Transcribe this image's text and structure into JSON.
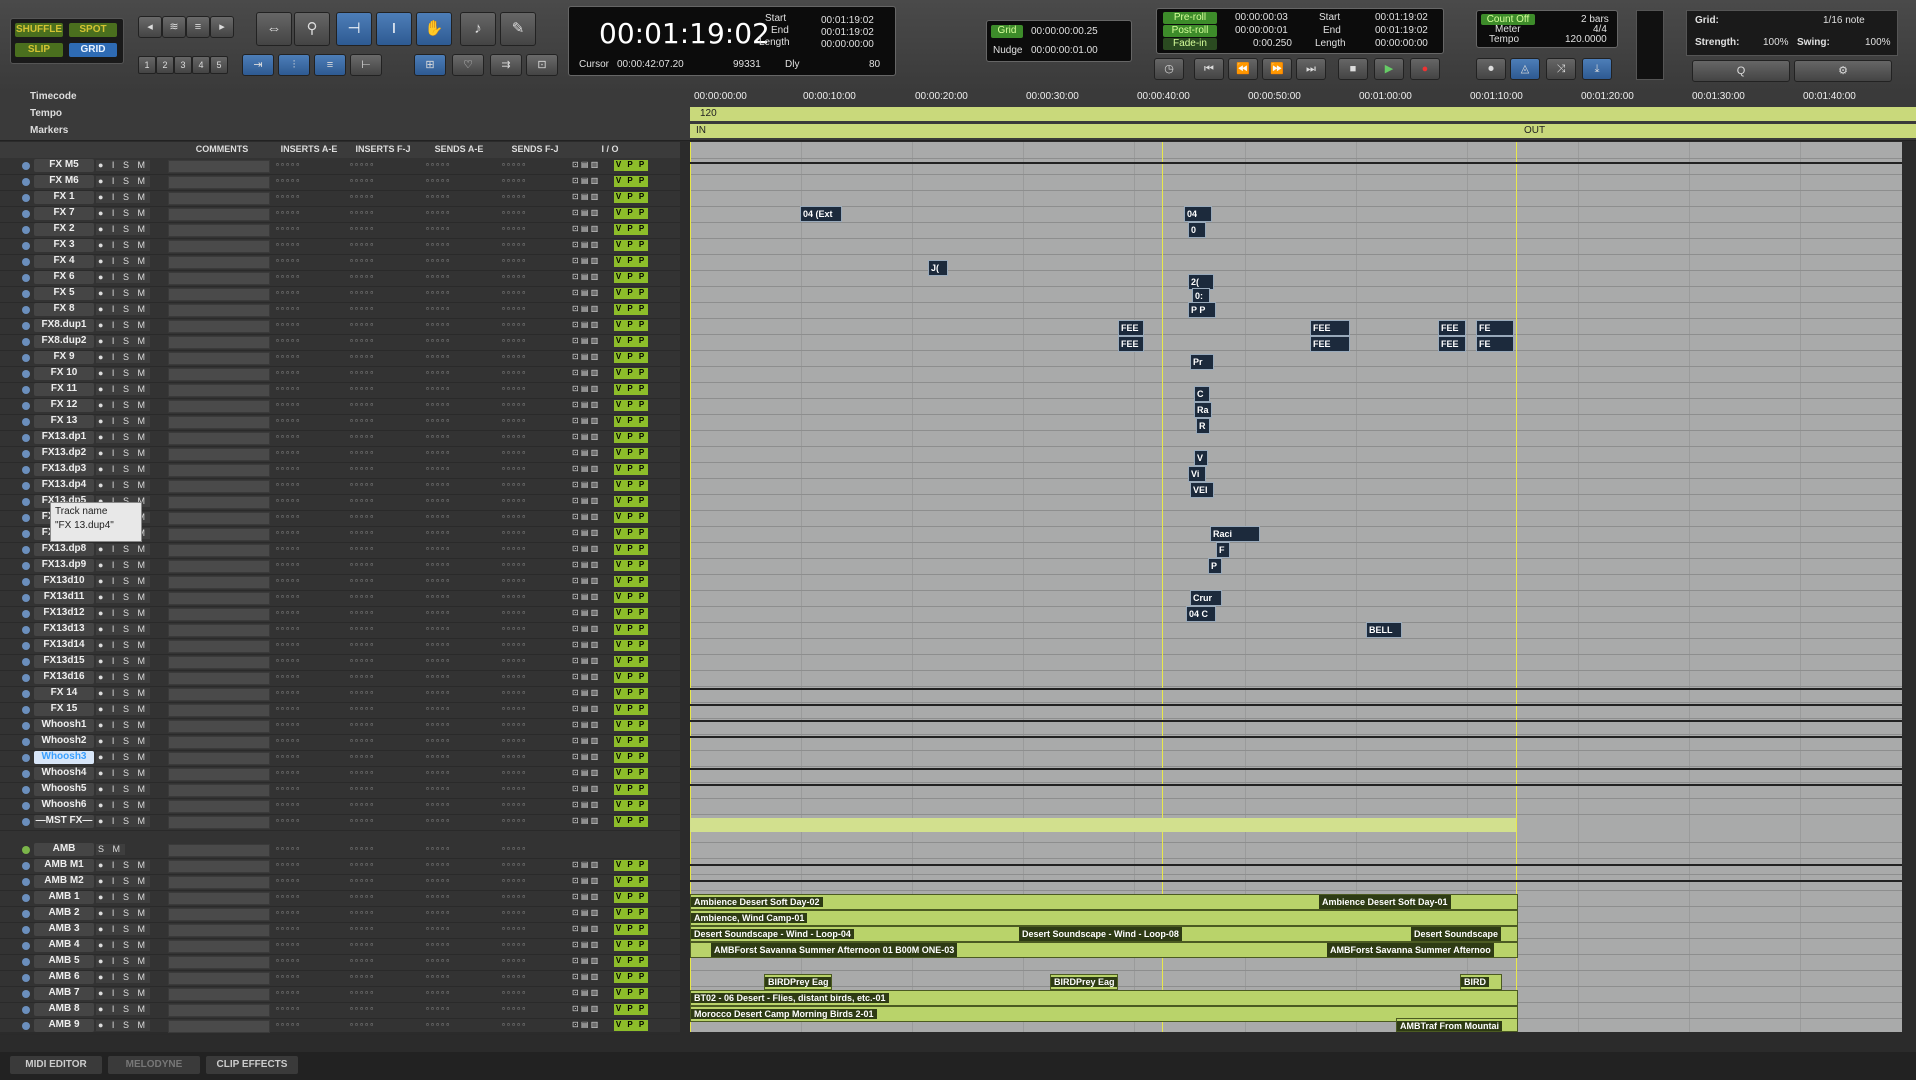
{
  "toolbar": {
    "edit_modes": [
      "SHUFFLE",
      "SPOT",
      "SLIP",
      "GRID"
    ],
    "zoom_presets": [
      "1",
      "2",
      "3",
      "4",
      "5"
    ],
    "main_counter": "00:01:19:02",
    "selection": {
      "start_label": "Start",
      "end_label": "End",
      "length_label": "Length",
      "start": "00:01:19:02",
      "end": "00:01:19:02",
      "length": "00:00:00:00"
    },
    "cursor_label": "Cursor",
    "cursor": "00:00:42:07.20",
    "sample_value": "99331",
    "dly_label": "Dly",
    "nudge_number": "80",
    "grid_label": "Grid",
    "grid_value": "00:00:00:00.25",
    "nudge_label": "Nudge",
    "nudge_value": "00:00:00:01.00",
    "preroll_label": "Pre-roll",
    "preroll": "00:00:00:03",
    "postroll_label": "Post-roll",
    "postroll": "00:00:00:01",
    "fadein_label": "Fade-in",
    "fadein": "0:00.250",
    "transport": {
      "start_label": "Start",
      "end_label": "End",
      "length_label": "Length",
      "start": "00:01:19:02",
      "end": "00:01:19:02",
      "length": "00:00:00:00"
    },
    "countoff_label": "Count Off",
    "countoff": "2 bars",
    "meter_label": "Meter",
    "meter": "4/4",
    "tempo_label": "Tempo",
    "tempo": "120.0000",
    "grid_right_label": "Grid:",
    "grid_note": "1/16 note",
    "strength_label": "Strength:",
    "strength": "100%",
    "swing_label": "Swing:",
    "swing": "100%"
  },
  "rulers": {
    "timecode_label": "Timecode",
    "tempo_label": "Tempo",
    "markers_label": "Markers",
    "tempo_value": "120",
    "in_label": "IN",
    "out_label": "OUT",
    "ticks": [
      "00:00:00:00",
      "00:00:10:00",
      "00:00:20:00",
      "00:00:30:00",
      "00:00:40:00",
      "00:00:50:00",
      "00:01:00:00",
      "00:01:10:00",
      "00:01:20:00",
      "00:01:30:00",
      "00:01:40:00"
    ]
  },
  "columns": [
    "COMMENTS",
    "INSERTS A-E",
    "INSERTS F-J",
    "SENDS A-E",
    "SENDS F-J",
    "I / O"
  ],
  "tracks": [
    "FX M5",
    "FX M6",
    "FX 1",
    "FX 7",
    "FX 2",
    "FX 3",
    "FX 4",
    "FX 6",
    "FX 5",
    "FX 8",
    "FX8.dup1",
    "FX8.dup2",
    "FX 9",
    "FX 10",
    "FX 11",
    "FX 12",
    "FX 13",
    "FX13.dp1",
    "FX13.dp2",
    "FX13.dp3",
    "FX13.dp4",
    "FX13.dp5",
    "FX13.dp6",
    "FX13.dp7",
    "FX13.dp8",
    "FX13.dp9",
    "FX13d10",
    "FX13d11",
    "FX13d12",
    "FX13d13",
    "FX13d14",
    "FX13d15",
    "FX13d16",
    "FX 14",
    "FX 15",
    "Whoosh1",
    "Whoosh2",
    "Whoosh3",
    "Whoosh4",
    "Whoosh5",
    "Whoosh6",
    "—MST FX—",
    "AMB",
    "AMB M1",
    "AMB M2",
    "AMB 1",
    "AMB 2",
    "AMB 3",
    "AMB 4",
    "AMB 5",
    "AMB 6",
    "AMB 7",
    "AMB 8",
    "AMB 9"
  ],
  "selected_track": "Whoosh3",
  "tooltip": {
    "title": "Track name",
    "value": "\"FX 13.dup4\""
  },
  "clips": {
    "c1": "04 (Ext",
    "c2": "04",
    "c3": "0",
    "c4": "J(",
    "c5": "2(",
    "c6": "0:",
    "c7": "P P",
    "c8": "FEE",
    "c9": "FEE",
    "c10": "FEE",
    "c11": "FEE",
    "c12": "FEE",
    "c13": "FE",
    "c14": "FEE",
    "c15": "FE",
    "c16": "Pr",
    "c17": "C",
    "c18": "Ra",
    "c19": "R",
    "c20": "V",
    "c21": "Vi",
    "c22": "VEI",
    "c23": "Raci",
    "c24": "F",
    "c25": "P",
    "c26": "Crur",
    "c27": "04 C",
    "c28": "BELL"
  },
  "amb_clips": {
    "a1": "Ambience Desert Soft Day-02",
    "a2": "Ambience Desert Soft Day-01",
    "a3": "Ambience, Wind Camp-01",
    "a4": "Desert Soundscape - Wind - Loop-04",
    "a5": "Desert Soundscape - Wind - Loop-08",
    "a6": "Desert Soundscape",
    "a7": "AMBForst Savanna Summer Afternoon 01 B00M ONE-03",
    "a8": "AMBForst Savanna Summer Afternoo",
    "a9": "BIRDPrey Eag",
    "a10": "BIRDPrey Eag",
    "a11": "BIRD",
    "a12": "BT02 - 06 Desert - Flies, distant birds, etc.-01",
    "a13": "Morocco Desert Camp Morning Birds 2-01",
    "a14": "AMBTraf From Mountai"
  },
  "bottom_tabs": [
    "MIDI EDITOR",
    "MELODYNE",
    "CLIP EFFECTS"
  ]
}
